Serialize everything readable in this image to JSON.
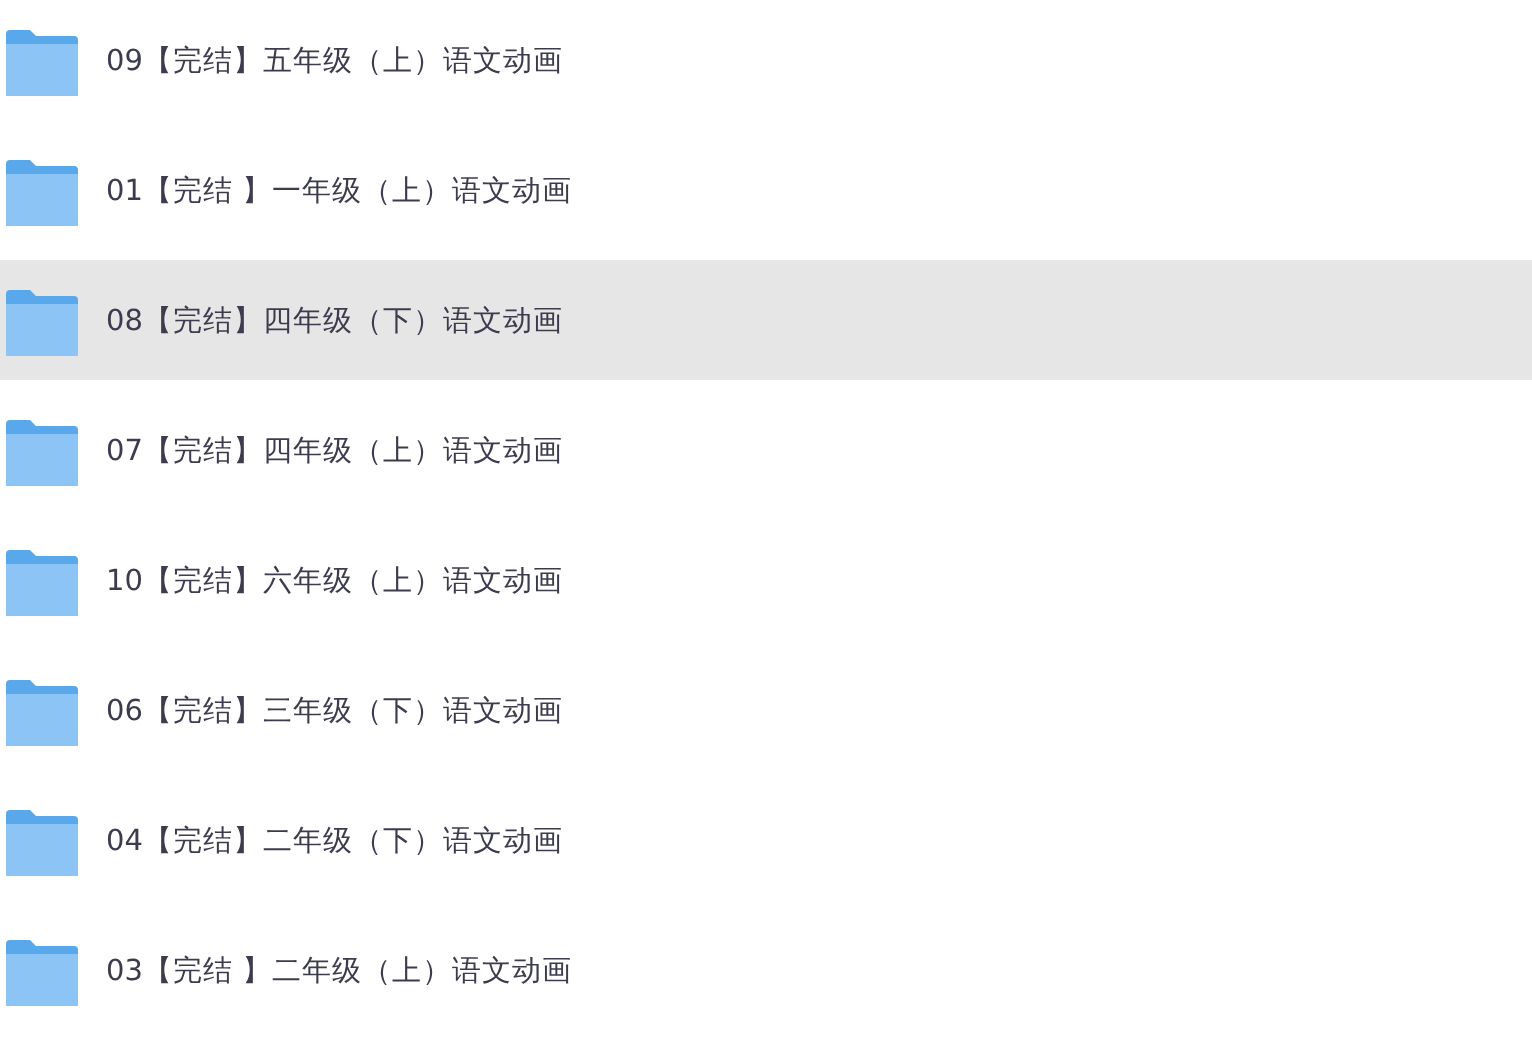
{
  "folders": [
    {
      "name": "09【完结】五年级（上）语文动画",
      "selected": false
    },
    {
      "name": "01【完结 】一年级（上）语文动画",
      "selected": false
    },
    {
      "name": "08【完结】四年级（下）语文动画",
      "selected": true
    },
    {
      "name": "07【完结】四年级（上）语文动画",
      "selected": false
    },
    {
      "name": "10【完结】六年级（上）语文动画",
      "selected": false
    },
    {
      "name": "06【完结】三年级（下）语文动画",
      "selected": false
    },
    {
      "name": "04【完结】二年级（下）语文动画",
      "selected": false
    },
    {
      "name": "03【完结 】二年级（上）语文动画",
      "selected": false
    }
  ]
}
